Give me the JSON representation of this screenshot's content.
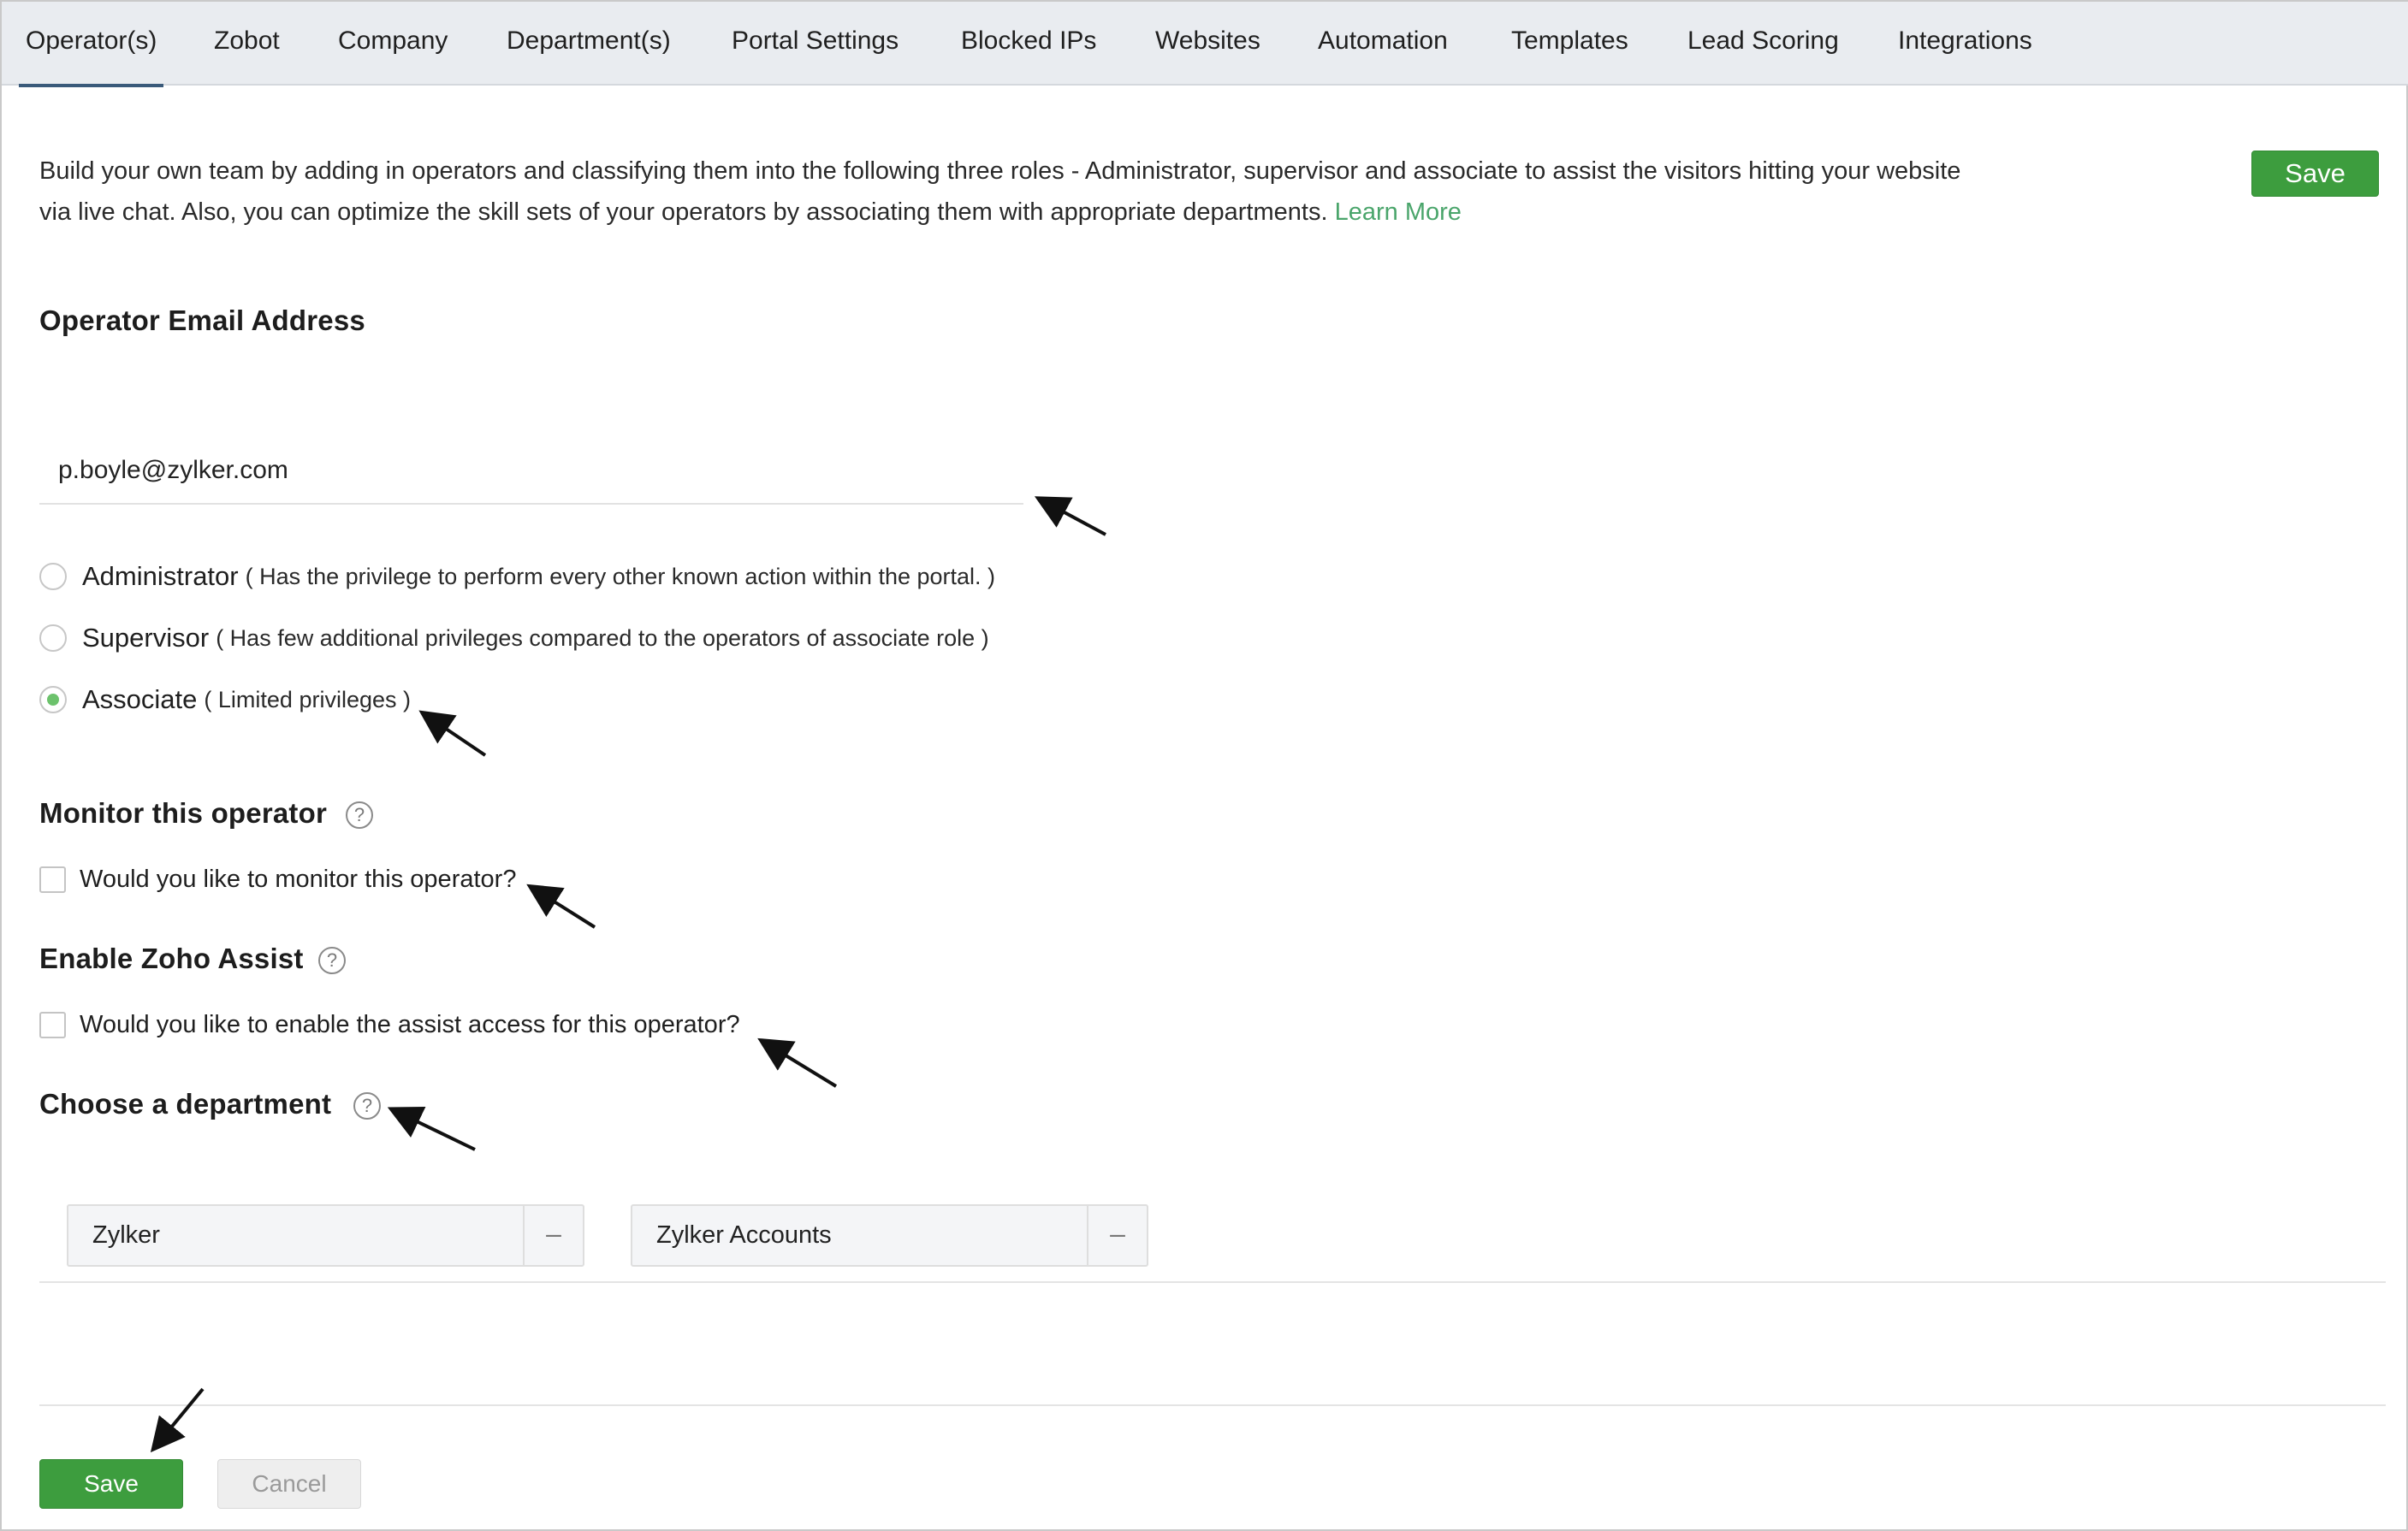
{
  "tabs": [
    {
      "label": "Operator(s)",
      "active": true
    },
    {
      "label": "Zobot"
    },
    {
      "label": "Company"
    },
    {
      "label": "Department(s)"
    },
    {
      "label": "Portal Settings"
    },
    {
      "label": "Blocked IPs"
    },
    {
      "label": "Websites"
    },
    {
      "label": "Automation"
    },
    {
      "label": "Templates"
    },
    {
      "label": "Lead Scoring"
    },
    {
      "label": "Integrations"
    }
  ],
  "intro": {
    "text": "Build your own team by adding in operators and classifying them into the following three roles - Administrator, supervisor and associate to assist the visitors hitting your website via live chat. Also, you can optimize the skill sets of your operators by associating them with appropriate departments.",
    "link": "Learn More"
  },
  "header_save_label": "Save",
  "email": {
    "title": "Operator Email Address",
    "value": "p.boyle@zylker.com"
  },
  "roles": [
    {
      "label": "Administrator",
      "desc": "( Has the privilege to perform every other known action within the portal. )",
      "checked": false
    },
    {
      "label": "Supervisor",
      "desc": "( Has few additional privileges compared to the operators of associate role )",
      "checked": false
    },
    {
      "label": "Associate",
      "desc": "( Limited privileges )",
      "checked": true
    }
  ],
  "monitor": {
    "title": "Monitor this operator",
    "checkbox_label": "Would you like to monitor this operator?",
    "checked": false
  },
  "assist": {
    "title": "Enable Zoho Assist",
    "checkbox_label": "Would you like to enable the assist access for this operator?",
    "checked": false
  },
  "department": {
    "title": "Choose a department",
    "selected": [
      "Zylker",
      "Zylker Accounts"
    ],
    "remove_glyph": "–"
  },
  "help_glyph": "?",
  "footer": {
    "save_label": "Save",
    "cancel_label": "Cancel"
  },
  "colors": {
    "accent_green": "#3d9d3e",
    "link_green": "#4aa56b",
    "tab_bar": "#e9ecf0"
  }
}
